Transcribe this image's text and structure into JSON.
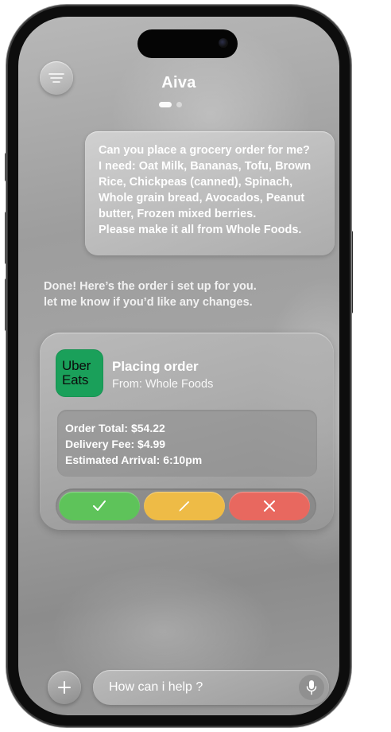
{
  "header": {
    "title": "Aiva",
    "menu_icon": "menu-lines-icon"
  },
  "pagination": {
    "current": 1,
    "total": 2
  },
  "messages": {
    "user_request": "Can you place a grocery order for me?\nI need: Oat Milk, Bananas, Tofu, Brown\nRice, Chickpeas (canned), Spinach,\nWhole grain bread, Avocados, Peanut\nbutter, Frozen mixed berries.\nPlease make it all from Whole Foods.",
    "assistant_reply": "Done! Here’s the order i set up for you.\nlet me know if you’d like any changes."
  },
  "order_card": {
    "app_logo_line1": "Uber",
    "app_logo_line2": "Eats",
    "title": "Placing order",
    "from": "From: Whole Foods",
    "order_total": "Order Total: $54.22",
    "delivery_fee": "Delivery Fee: $4.99",
    "estimated_arrival": "Estimated Arrival: 6:10pm",
    "actions": [
      {
        "name": "confirm",
        "icon": "check-icon",
        "color": "#5ec35a"
      },
      {
        "name": "edit",
        "icon": "pencil-icon",
        "color": "#eebb46"
      },
      {
        "name": "cancel",
        "icon": "close-icon",
        "color": "#e8685f"
      }
    ],
    "brand_color": "#1aa05a"
  },
  "composer": {
    "placeholder": "How can i help ?",
    "plus_icon": "plus-icon",
    "mic_icon": "microphone-icon"
  }
}
